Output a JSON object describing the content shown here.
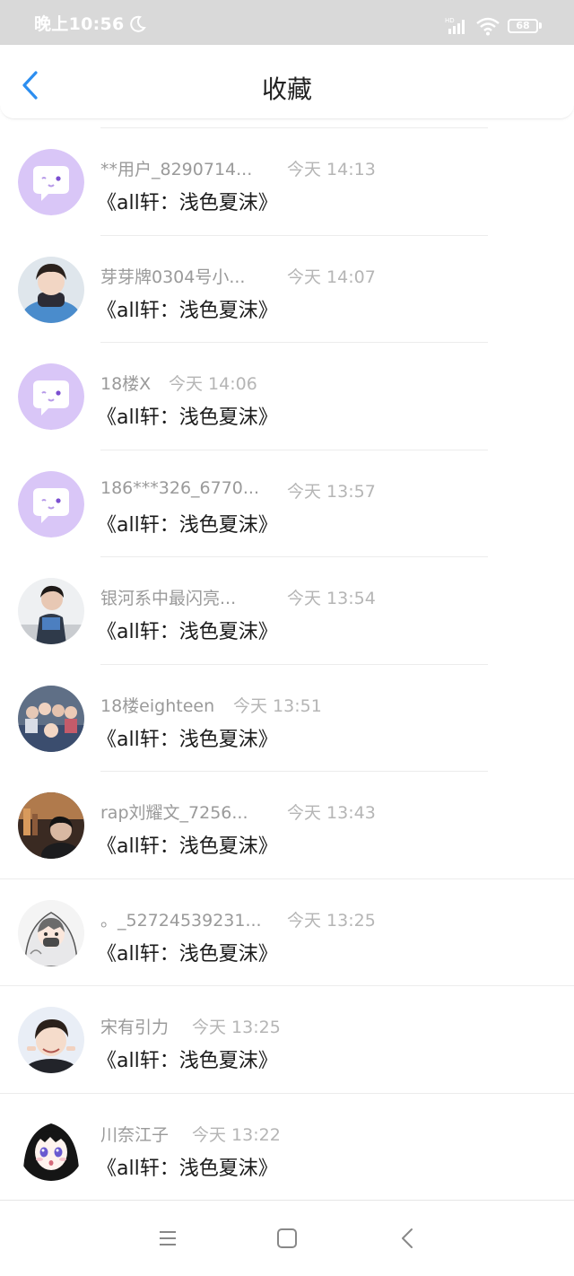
{
  "status_bar": {
    "time": "晚上10:56",
    "network": "HD",
    "battery": "68"
  },
  "header": {
    "title": "收藏"
  },
  "items": [
    {
      "user": "**用户_8290714...",
      "time": "今天 14:13",
      "title": "《all轩：浅色夏沫》",
      "avatar": "default"
    },
    {
      "user": "芽芽牌0304号小...",
      "time": "今天 14:07",
      "title": "《all轩：浅色夏沫》",
      "avatar": "photo-boy-blue"
    },
    {
      "user": "18楼X",
      "time": "今天 14:06",
      "title": "《all轩：浅色夏沫》",
      "avatar": "default"
    },
    {
      "user": "186***326_6770...",
      "time": "今天 13:57",
      "title": "《all轩：浅色夏沫》",
      "avatar": "default"
    },
    {
      "user": "银河系中最闪亮...",
      "time": "今天 13:54",
      "title": "《all轩：浅色夏沫》",
      "avatar": "photo-boy-dance"
    },
    {
      "user": "18楼eighteen",
      "time": "今天 13:51",
      "title": "《all轩：浅色夏沫》",
      "avatar": "photo-group"
    },
    {
      "user": "rap刘耀文_7256...",
      "time": "今天 13:43",
      "title": "《all轩：浅色夏沫》",
      "avatar": "photo-street"
    },
    {
      "user": "。_52724539231...",
      "time": "今天 13:25",
      "title": "《all轩：浅色夏沫》",
      "avatar": "anime-hood"
    },
    {
      "user": "宋有引力",
      "time": "今天 13:25",
      "title": "《all轩：浅色夏沫》",
      "avatar": "photo-boy-smile"
    },
    {
      "user": "川奈江子",
      "time": "今天 13:22",
      "title": "《all轩：浅色夏沫》",
      "avatar": "anime-girl"
    }
  ],
  "colors": {
    "accent": "#2c8ef0",
    "default_avatar": "#d9c6f7"
  }
}
